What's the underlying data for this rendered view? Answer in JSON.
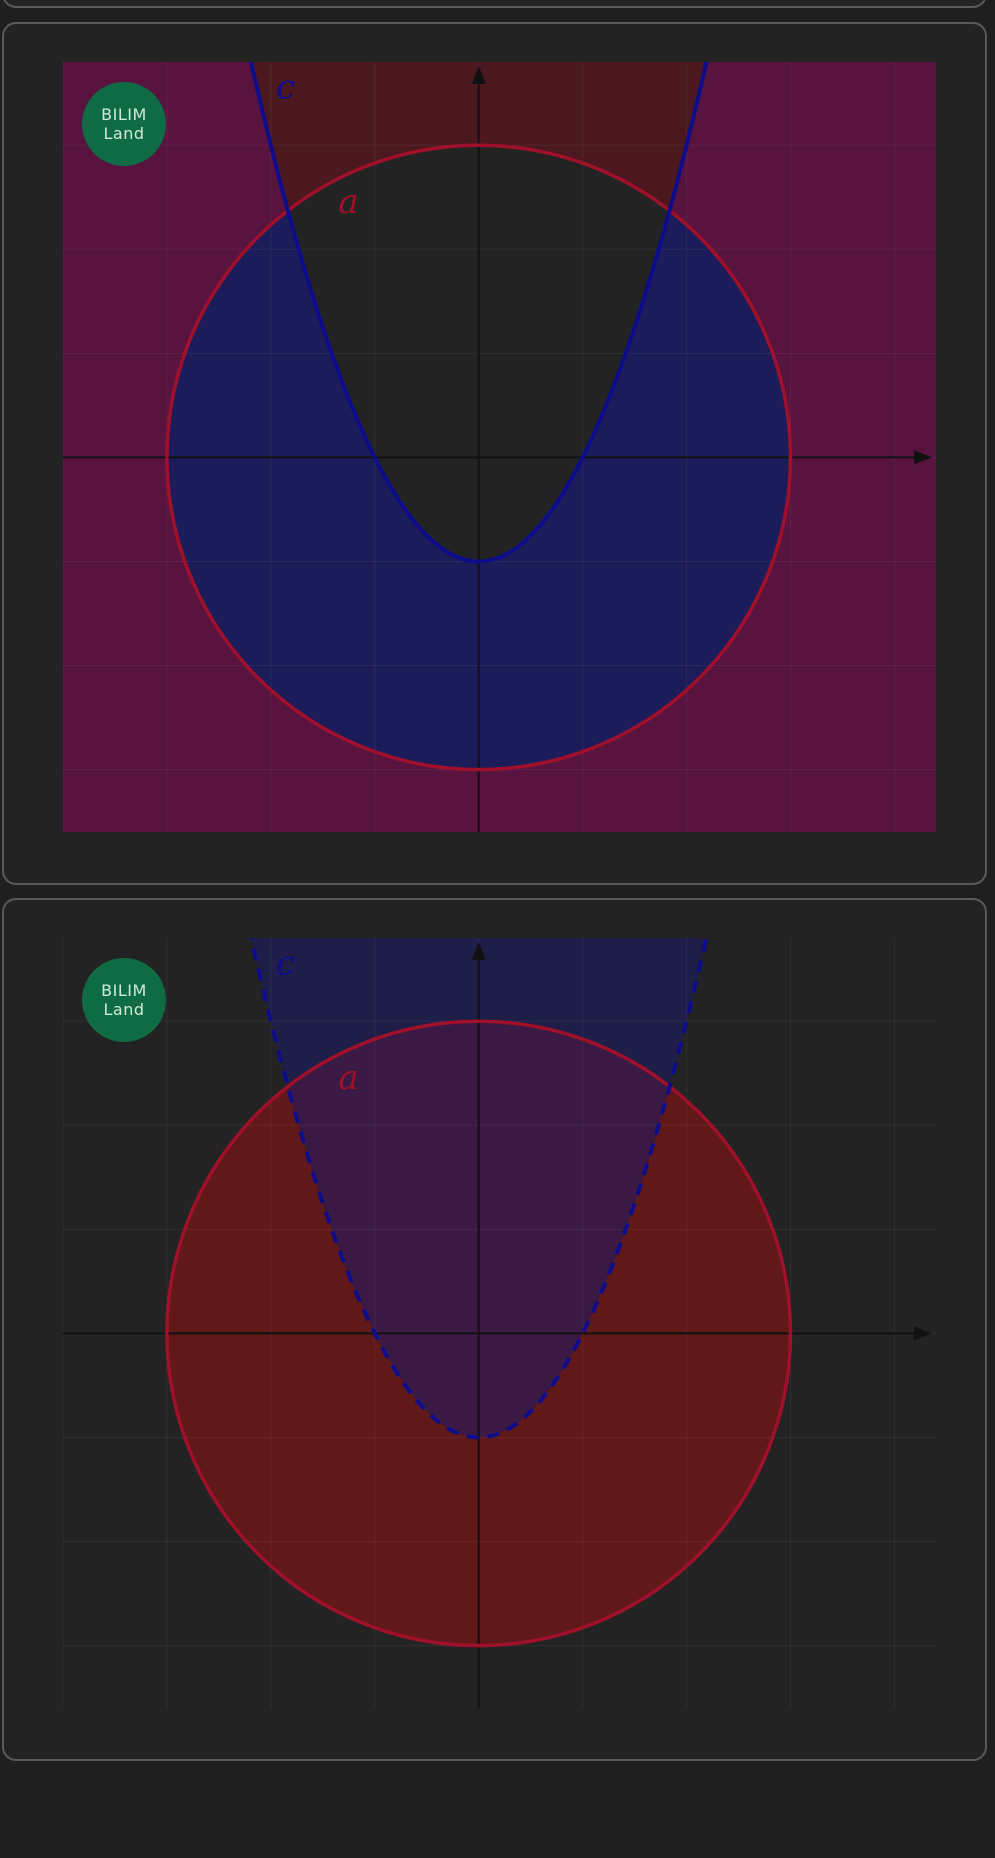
{
  "logo": {
    "line1": "BILIM",
    "line2": "Land"
  },
  "colors": {
    "background": "#1f1f1f",
    "card": "#232323",
    "card_border": "#5a5a5a",
    "circle": "#a0102a",
    "parabola": "#0d0d8c",
    "logo_bg": "#0f6b44"
  },
  "chart_data": [
    {
      "type": "area",
      "xlim": [
        -4,
        4.4
      ],
      "ylim": [
        -3.6,
        3.8
      ],
      "grid": true,
      "curves": [
        {
          "label": "a",
          "kind": "circle",
          "center": [
            0,
            0
          ],
          "radius": 3,
          "style": "solid",
          "color": "#a0102a"
        },
        {
          "label": "c",
          "kind": "parabola",
          "equation": "y = x^2 - 1",
          "style": "solid",
          "color": "#0d0d8c"
        }
      ],
      "shading": [
        {
          "region": "outside circle a",
          "color": "#6b0f4a"
        },
        {
          "region": "inside circle a, below parabola c",
          "color": "#1c1c5a"
        },
        {
          "region": "outside circle a, above parabola c",
          "color": "#4a1a1a"
        }
      ]
    },
    {
      "type": "area",
      "xlim": [
        -4,
        4.4
      ],
      "ylim": [
        -3.6,
        3.8
      ],
      "grid": true,
      "curves": [
        {
          "label": "a",
          "kind": "circle",
          "center": [
            0,
            0
          ],
          "radius": 3,
          "style": "solid",
          "color": "#a0102a"
        },
        {
          "label": "c",
          "kind": "parabola",
          "equation": "y = x^2 - 1",
          "style": "dashed",
          "color": "#0d0d8c"
        }
      ],
      "shading": [
        {
          "region": "inside circle a",
          "color": "#7a1414"
        },
        {
          "region": "above parabola c",
          "color": "#1c1c6a"
        }
      ]
    }
  ]
}
